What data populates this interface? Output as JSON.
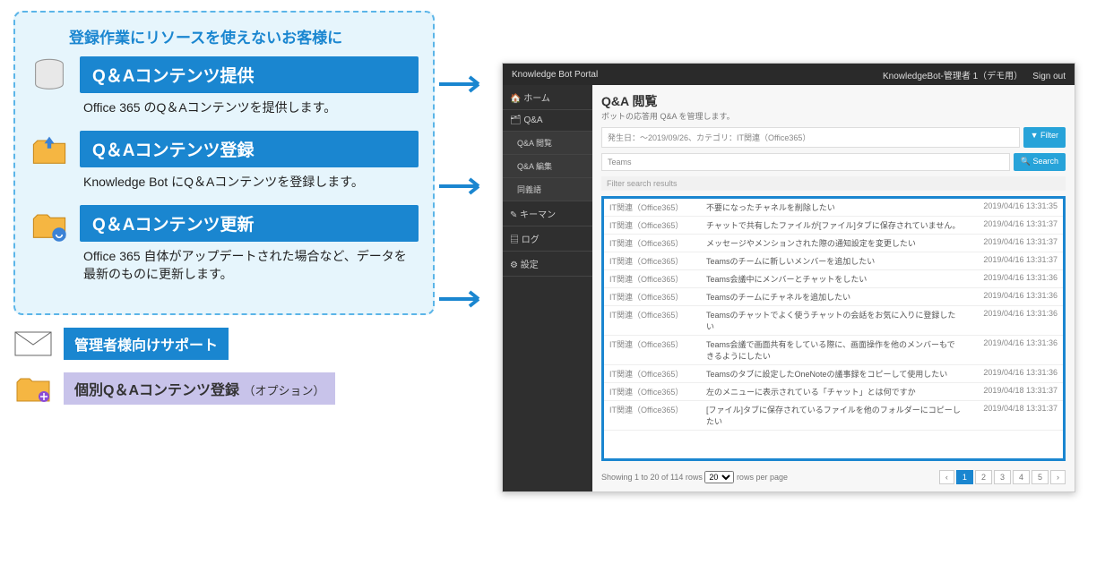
{
  "promo": {
    "headline": "登録作業にリソースを使えないお客様に",
    "features": [
      {
        "title": "Q＆Aコンテンツ提供",
        "desc": "Office 365 のQ＆Aコンテンツを提供します。"
      },
      {
        "title": "Q＆Aコンテンツ登録",
        "desc": "Knowledge Bot にQ＆Aコンテンツを登録します。"
      },
      {
        "title": "Q＆Aコンテンツ更新",
        "desc": "Office 365 自体がアップデートされた場合など、データを最新のものに更新します。"
      }
    ],
    "support_label": "管理者様向けサポート",
    "option_label": "個別Q＆Aコンテンツ登録",
    "option_suffix": "（オプション）"
  },
  "portal": {
    "app_title": "Knowledge Bot Portal",
    "user_label": "KnowledgeBot-管理者 1（デモ用）",
    "signout": "Sign out",
    "nav": {
      "home": "ホーム",
      "qa": "Q&A",
      "qa_view": "Q&A 閲覧",
      "qa_edit": "Q&A 編集",
      "sync": "同義語",
      "keyman": "キーマン",
      "log": "ログ",
      "settings": "設定"
    },
    "page_title": "Q&A 閲覧",
    "page_sub": "ボットの応答用 Q&A を管理します。",
    "filter_text": "発生日：〜2019/09/26、カテゴリ：IT関連（Office365）",
    "filter_btn": "Filter",
    "search_value": "Teams",
    "search_btn": "Search",
    "results_header": "Filter search results",
    "rows": [
      {
        "cat": "IT関連（Office365）",
        "txt": "不要になったチャネルを削除したい",
        "dt": "2019/04/16 13:31:35"
      },
      {
        "cat": "IT関連（Office365）",
        "txt": "チャットで共有したファイルが[ファイル]タブに保存されていません。",
        "dt": "2019/04/16 13:31:37"
      },
      {
        "cat": "IT関連（Office365）",
        "txt": "メッセージやメンションされた際の通知設定を変更したい",
        "dt": "2019/04/16 13:31:37"
      },
      {
        "cat": "IT関連（Office365）",
        "txt": "Teamsのチームに新しいメンバーを追加したい",
        "dt": "2019/04/16 13:31:37"
      },
      {
        "cat": "IT関連（Office365）",
        "txt": "Teams会議中にメンバーとチャットをしたい",
        "dt": "2019/04/16 13:31:36"
      },
      {
        "cat": "IT関連（Office365）",
        "txt": "Teamsのチームにチャネルを追加したい",
        "dt": "2019/04/16 13:31:36"
      },
      {
        "cat": "IT関連（Office365）",
        "txt": "Teamsのチャットでよく使うチャットの会話をお気に入りに登録したい",
        "dt": "2019/04/16 13:31:36"
      },
      {
        "cat": "IT関連（Office365）",
        "txt": "Teams会議で画面共有をしている際に、画面操作を他のメンバーもできるようにしたい",
        "dt": "2019/04/16 13:31:36"
      },
      {
        "cat": "IT関連（Office365）",
        "txt": "Teamsのタブに設定したOneNoteの議事録をコピーして使用したい",
        "dt": "2019/04/16 13:31:36"
      },
      {
        "cat": "IT関連（Office365）",
        "txt": "左のメニューに表示されている「チャット」とは何ですか",
        "dt": "2019/04/18 13:31:37"
      },
      {
        "cat": "IT関連（Office365）",
        "txt": "[ファイル]タブに保存されているファイルを他のフォルダーにコピーしたい",
        "dt": "2019/04/18 13:31:37"
      }
    ],
    "pager_text": "Showing 1 to 20 of 114 rows",
    "per_page": "20",
    "per_page_suffix": "rows per page",
    "pages": [
      "‹",
      "1",
      "2",
      "3",
      "4",
      "5",
      "›"
    ]
  }
}
